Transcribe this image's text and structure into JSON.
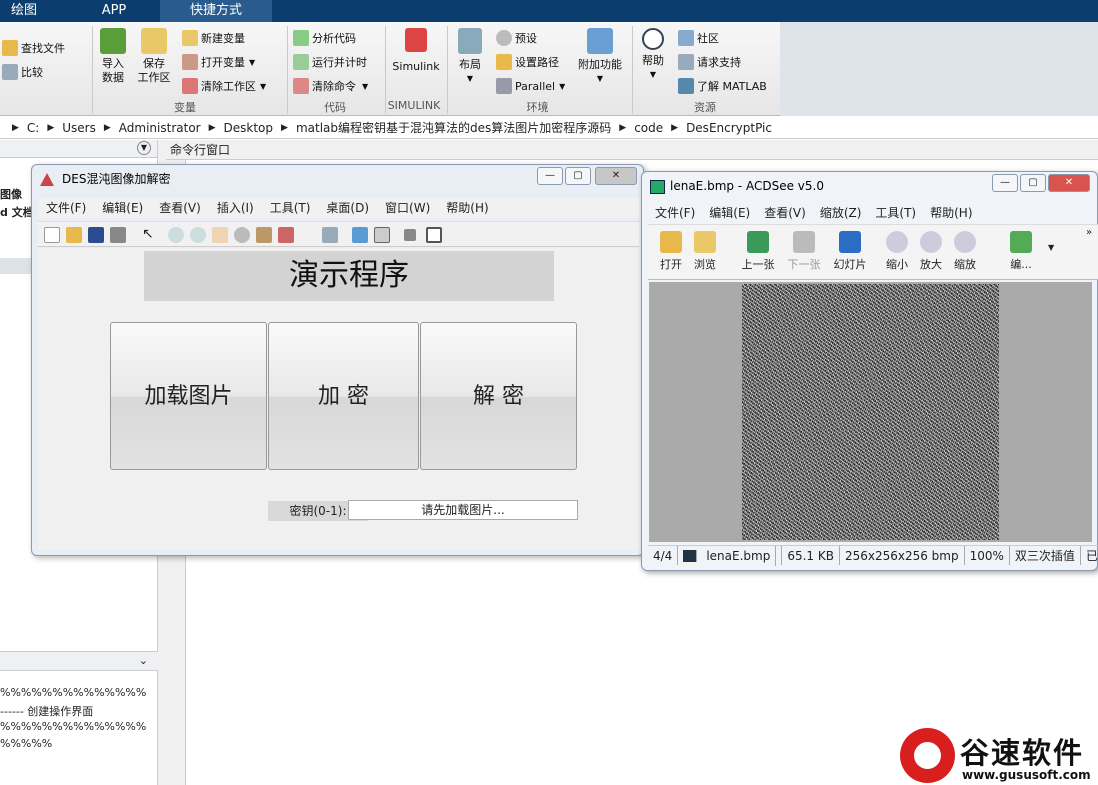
{
  "tabs": [
    "绘图",
    "APP",
    "快捷方式"
  ],
  "ribbon": {
    "find_files": "查找文件",
    "compare": "比较",
    "import_data": "导入\n数据",
    "save_workspace": "保存\n工作区",
    "new_variable": "新建变量",
    "open_variable": "打开变量",
    "clear_workspace": "清除工作区",
    "analyze_code": "分析代码",
    "run_and_time": "运行并计时",
    "clear_commands": "清除命令",
    "simulink": "Simulink",
    "layout": "布局",
    "preferences": "预设",
    "set_path": "设置路径",
    "parallel": "Parallel",
    "addons": "附加功能",
    "help": "帮助",
    "community": "社区",
    "request_support": "请求支持",
    "learn_matlab": "了解 MATLAB",
    "groups": {
      "variable": "变量",
      "code": "代码",
      "simulink": "SIMULINK",
      "environment": "环境",
      "resources": "资源"
    }
  },
  "address": {
    "segments": [
      "C:",
      "Users",
      "Administrator",
      "Desktop",
      "matlab编程密钥基于混沌算法的des算法图片加密程序源码",
      "code",
      "DesEncryptPic"
    ]
  },
  "left_pane": {
    "item1": "图像",
    "item2": "d 文档",
    "lines": [
      "%%%%%%%%%%%%%%",
      "------ 创建操作界面",
      "%%%%%%%%%%%%%%",
      "%%%%%"
    ]
  },
  "command_window": {
    "title": "命令行窗口"
  },
  "figure": {
    "title": "DES混沌图像加解密",
    "menus": [
      "文件(F)",
      "编辑(E)",
      "查看(V)",
      "插入(I)",
      "工具(T)",
      "桌面(D)",
      "窗口(W)",
      "帮助(H)"
    ],
    "heading": "演示程序",
    "load_button": "加载图片",
    "encrypt_button": "加 密",
    "decrypt_button": "解 密",
    "key_label": "密钥(0-1):",
    "key_value": "请先加载图片..."
  },
  "acdsee": {
    "title": "lenaE.bmp - ACDSee v5.0",
    "menus": [
      "文件(F)",
      "编辑(E)",
      "查看(V)",
      "缩放(Z)",
      "工具(T)",
      "帮助(H)"
    ],
    "toolbar": [
      "打开",
      "浏览",
      "上一张",
      "下一张",
      "幻灯片",
      "缩小",
      "放大",
      "缩放",
      "编..."
    ],
    "status": [
      "4/4",
      "lenaE.bmp",
      "65.1 KB",
      "256x256x256 bmp",
      "100%",
      "双三次插值",
      "已载入"
    ]
  },
  "logo": {
    "name": "谷速软件",
    "url": "www.gususoft.com"
  }
}
